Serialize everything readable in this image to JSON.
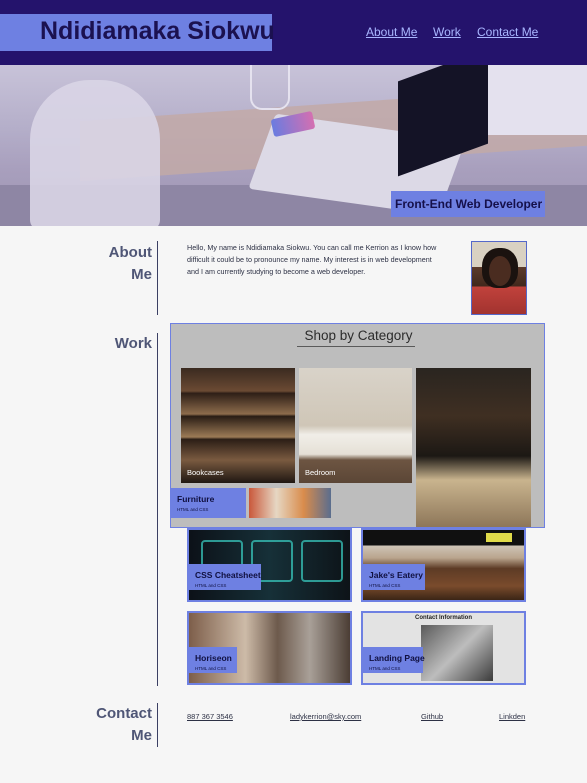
{
  "header": {
    "name": "Ndidiamaka Siokwu",
    "nav": [
      "About Me",
      "Work",
      "Contact Me"
    ]
  },
  "hero": {
    "badge": "Front-End Web Developer"
  },
  "about": {
    "title_line1": "About",
    "title_line2": "Me",
    "text": "Hello, My name is Ndidiamaka Siokwu. You can call me Kerrion as I know how difficult it could be to pronounce my name. My interest is in web development and I am currently studying to become a web developer."
  },
  "work": {
    "title": "Work",
    "featured": {
      "screenshot_title": "Shop by Category",
      "categories": [
        "Bookcases",
        "Bedroom"
      ],
      "label": "Furniture",
      "sub": "HTML and CSS"
    },
    "projects": [
      {
        "title": "CSS Cheatsheet",
        "sub": "HTML and CSS"
      },
      {
        "title": "Jake's Eatery",
        "sub": "HTML and CSS"
      },
      {
        "title": "Horiseon",
        "sub": "HTML and CSS"
      },
      {
        "title": "Landing Page",
        "sub": "HTML and CSS",
        "screenshot_header": "Contact Information"
      }
    ]
  },
  "contact": {
    "title_line1": "Contact",
    "title_line2": "Me",
    "links": [
      "887 367 3546",
      "ladykerrion@sky.com",
      "Github",
      "Linkden"
    ]
  },
  "colors": {
    "header_bg": "#24136c",
    "accent": "#6e80e2",
    "page_bg": "#f6f6f6"
  }
}
